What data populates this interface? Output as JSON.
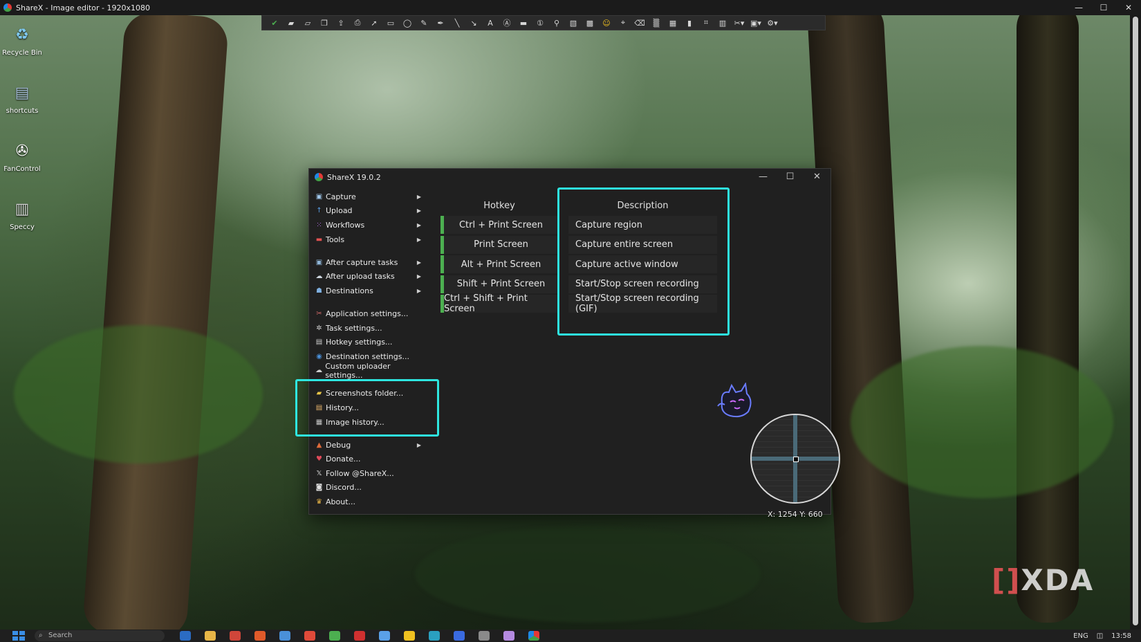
{
  "topbar": {
    "title": "ShareX - Image editor - 1920x1080"
  },
  "toolbar": {
    "tools": [
      "confirm-icon",
      "save-icon",
      "save-as-icon",
      "copy-icon",
      "upload-icon",
      "print-icon",
      "select-icon",
      "rectangle-icon",
      "ellipse-icon",
      "freehand-icon",
      "pen-icon",
      "line-icon",
      "arrow-icon",
      "text-icon",
      "text-background-icon",
      "speech-balloon-icon",
      "step-icon",
      "magnify-icon",
      "image-icon",
      "sticker-icon",
      "emoji-icon",
      "cursor-icon",
      "eraser-icon",
      "blur-icon",
      "pixelate-icon",
      "highlight-icon",
      "crop-icon",
      "cut-icon",
      "shapes-dropdown-icon",
      "capture-dropdown-icon",
      "settings-icon"
    ]
  },
  "desktop": [
    {
      "label": "Recycle Bin",
      "icon": "recycle-bin-icon",
      "glyph": "♻",
      "color": "#7ec8f0"
    },
    {
      "label": "shortcuts",
      "icon": "folder-icon",
      "glyph": "▤",
      "color": "#9fb6d0"
    },
    {
      "label": "FanControl",
      "icon": "fan-icon",
      "glyph": "✇",
      "color": "#ffffff"
    },
    {
      "label": "Speccy",
      "icon": "speccy-icon",
      "glyph": "▥",
      "color": "#d0d0d0"
    }
  ],
  "window": {
    "title": "ShareX 19.0.2",
    "controls": {
      "minimize": "—",
      "maximize": "☐",
      "close": "✕"
    }
  },
  "menu": [
    {
      "label": "Capture",
      "icon": "capture-icon",
      "glyph": "▣",
      "color": "#9ec5e8",
      "submenu": true
    },
    {
      "label": "Upload",
      "icon": "upload-arrow-icon",
      "glyph": "↑",
      "color": "#5aa0e8",
      "submenu": true
    },
    {
      "label": "Workflows",
      "icon": "workflows-icon",
      "glyph": "⁙",
      "color": "#b26be0",
      "submenu": true
    },
    {
      "label": "Tools",
      "icon": "tools-icon",
      "glyph": "▬",
      "color": "#e05252",
      "submenu": true
    },
    {
      "separator": true
    },
    {
      "label": "After capture tasks",
      "icon": "after-capture-icon",
      "glyph": "▣",
      "color": "#8fb6d8",
      "submenu": true
    },
    {
      "label": "After upload tasks",
      "icon": "after-upload-icon",
      "glyph": "☁",
      "color": "#cfd8e0",
      "submenu": true
    },
    {
      "label": "Destinations",
      "icon": "destinations-icon",
      "glyph": "☗",
      "color": "#7fb0e0",
      "submenu": true
    },
    {
      "separator": true
    },
    {
      "label": "Application settings...",
      "icon": "app-settings-icon",
      "glyph": "✂",
      "color": "#d96b6b"
    },
    {
      "label": "Task settings...",
      "icon": "task-settings-icon",
      "glyph": "✲",
      "color": "#d0d0d0"
    },
    {
      "label": "Hotkey settings...",
      "icon": "hotkey-settings-icon",
      "glyph": "▤",
      "color": "#d0d0d0"
    },
    {
      "label": "Destination settings...",
      "icon": "destination-settings-icon",
      "glyph": "◉",
      "color": "#4a90d9"
    },
    {
      "label": "Custom uploader settings...",
      "icon": "custom-uploader-icon",
      "glyph": "☁",
      "color": "#d0d0d0"
    },
    {
      "separator": true
    },
    {
      "label": "Screenshots folder...",
      "icon": "screenshots-folder-icon",
      "glyph": "▰",
      "color": "#e8c547"
    },
    {
      "label": "History...",
      "icon": "history-icon",
      "glyph": "▤",
      "color": "#e8b56b"
    },
    {
      "label": "Image history...",
      "icon": "image-history-icon",
      "glyph": "▦",
      "color": "#c8c8c8"
    },
    {
      "separator": true
    },
    {
      "label": "Debug",
      "icon": "debug-icon",
      "glyph": "▲",
      "color": "#e06b3a",
      "submenu": true
    },
    {
      "label": "Donate...",
      "icon": "heart-icon",
      "glyph": "♥",
      "color": "#e04a5a"
    },
    {
      "label": "Follow @ShareX...",
      "icon": "x-logo-icon",
      "glyph": "𝕏",
      "color": "#e0e0e0"
    },
    {
      "label": "Discord...",
      "icon": "discord-icon",
      "glyph": "◙",
      "color": "#e0e0e0"
    },
    {
      "label": "About...",
      "icon": "crown-icon",
      "glyph": "♛",
      "color": "#e8b547"
    }
  ],
  "hotkeys": {
    "headers": {
      "hotkey": "Hotkey",
      "description": "Description"
    },
    "rows": [
      {
        "hotkey": "Ctrl + Print Screen",
        "description": "Capture region"
      },
      {
        "hotkey": "Print Screen",
        "description": "Capture entire screen"
      },
      {
        "hotkey": "Alt + Print Screen",
        "description": "Capture active window"
      },
      {
        "hotkey": "Shift + Print Screen",
        "description": "Start/Stop screen recording"
      },
      {
        "hotkey": "Ctrl + Shift + Print Screen",
        "description": "Start/Stop screen recording (GIF)"
      }
    ]
  },
  "magnifier": {
    "coords": "X: 1254 Y: 660"
  },
  "watermark": {
    "text": "XDA"
  },
  "taskbar": {
    "search_placeholder": "Search",
    "language": "ENG",
    "time": "13:58"
  },
  "colors": {
    "highlight": "#2ee6e0",
    "hotkey_bar": "#4caf50"
  }
}
